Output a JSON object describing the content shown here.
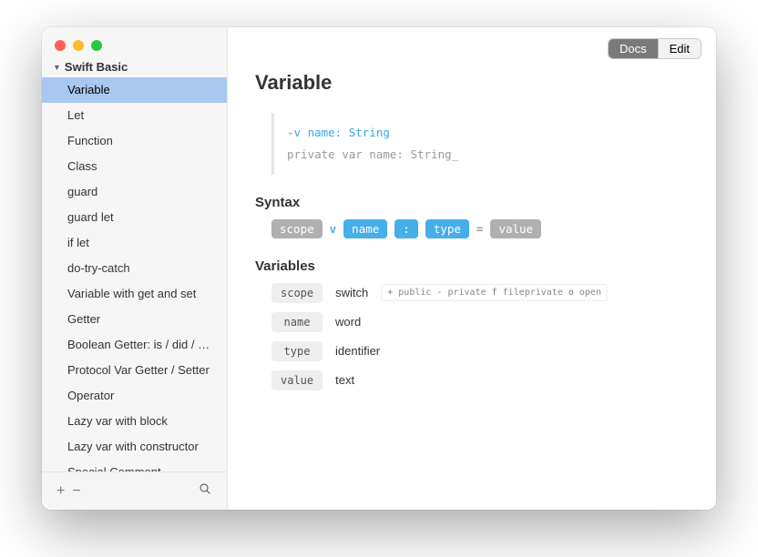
{
  "header": {
    "docs": "Docs",
    "edit": "Edit"
  },
  "sidebar": {
    "folder": "Swift Basic",
    "items": [
      "Variable",
      "Let",
      "Function",
      "Class",
      "guard",
      "guard let",
      "if let",
      "do-try-catch",
      "Variable with get and set",
      "Getter",
      "Boolean Getter: is / did / ha...",
      "Protocol Var Getter / Setter",
      "Operator",
      "Lazy var with block",
      "Lazy var with constructor",
      "Special Comment"
    ],
    "selected_index": 0
  },
  "content": {
    "title": "Variable",
    "code_line1": "-v name: String",
    "code_line2": "private var name: String",
    "syntax_heading": "Syntax",
    "syntax_tokens": {
      "scope": "scope",
      "v": "v",
      "name": "name",
      "colon": ":",
      "type": "type",
      "eq": "=",
      "value": "value"
    },
    "variables_heading": "Variables",
    "variables": [
      {
        "name": "scope",
        "desc": "switch",
        "opts": [
          {
            "k": "+",
            "v": "public"
          },
          {
            "k": "-",
            "v": "private"
          },
          {
            "k": "f",
            "v": "fileprivate"
          },
          {
            "k": "o",
            "v": "open"
          }
        ]
      },
      {
        "name": "name",
        "desc": "word"
      },
      {
        "name": "type",
        "desc": "identifier"
      },
      {
        "name": "value",
        "desc": "text"
      }
    ]
  }
}
